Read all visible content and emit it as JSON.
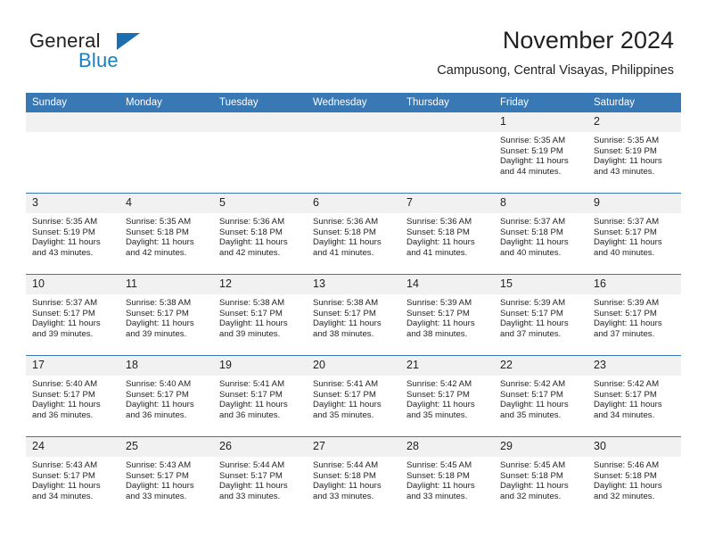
{
  "brand": {
    "word_one": "General",
    "word_two": "Blue",
    "logo_icon": "triangle-logo-icon",
    "accent_color": "#1a7fc1"
  },
  "header": {
    "month_title": "November 2024",
    "location": "Campusong, Central Visayas, Philippines"
  },
  "calendar": {
    "header_color": "#3878b5",
    "daynum_background": "#f1f1f1",
    "weekday_headers": [
      "Sunday",
      "Monday",
      "Tuesday",
      "Wednesday",
      "Thursday",
      "Friday",
      "Saturday"
    ],
    "labels": {
      "sunrise": "Sunrise:",
      "sunset": "Sunset:",
      "daylight": "Daylight:"
    },
    "weeks": [
      [
        {
          "day": "",
          "blank": true
        },
        {
          "day": "",
          "blank": true
        },
        {
          "day": "",
          "blank": true
        },
        {
          "day": "",
          "blank": true
        },
        {
          "day": "",
          "blank": true
        },
        {
          "day": "1",
          "sunrise": "Sunrise: 5:35 AM",
          "sunset": "Sunset: 5:19 PM",
          "daylight": "Daylight: 11 hours and 44 minutes."
        },
        {
          "day": "2",
          "sunrise": "Sunrise: 5:35 AM",
          "sunset": "Sunset: 5:19 PM",
          "daylight": "Daylight: 11 hours and 43 minutes."
        }
      ],
      [
        {
          "day": "3",
          "sunrise": "Sunrise: 5:35 AM",
          "sunset": "Sunset: 5:19 PM",
          "daylight": "Daylight: 11 hours and 43 minutes."
        },
        {
          "day": "4",
          "sunrise": "Sunrise: 5:35 AM",
          "sunset": "Sunset: 5:18 PM",
          "daylight": "Daylight: 11 hours and 42 minutes."
        },
        {
          "day": "5",
          "sunrise": "Sunrise: 5:36 AM",
          "sunset": "Sunset: 5:18 PM",
          "daylight": "Daylight: 11 hours and 42 minutes."
        },
        {
          "day": "6",
          "sunrise": "Sunrise: 5:36 AM",
          "sunset": "Sunset: 5:18 PM",
          "daylight": "Daylight: 11 hours and 41 minutes."
        },
        {
          "day": "7",
          "sunrise": "Sunrise: 5:36 AM",
          "sunset": "Sunset: 5:18 PM",
          "daylight": "Daylight: 11 hours and 41 minutes."
        },
        {
          "day": "8",
          "sunrise": "Sunrise: 5:37 AM",
          "sunset": "Sunset: 5:18 PM",
          "daylight": "Daylight: 11 hours and 40 minutes."
        },
        {
          "day": "9",
          "sunrise": "Sunrise: 5:37 AM",
          "sunset": "Sunset: 5:17 PM",
          "daylight": "Daylight: 11 hours and 40 minutes."
        }
      ],
      [
        {
          "day": "10",
          "sunrise": "Sunrise: 5:37 AM",
          "sunset": "Sunset: 5:17 PM",
          "daylight": "Daylight: 11 hours and 39 minutes."
        },
        {
          "day": "11",
          "sunrise": "Sunrise: 5:38 AM",
          "sunset": "Sunset: 5:17 PM",
          "daylight": "Daylight: 11 hours and 39 minutes."
        },
        {
          "day": "12",
          "sunrise": "Sunrise: 5:38 AM",
          "sunset": "Sunset: 5:17 PM",
          "daylight": "Daylight: 11 hours and 39 minutes."
        },
        {
          "day": "13",
          "sunrise": "Sunrise: 5:38 AM",
          "sunset": "Sunset: 5:17 PM",
          "daylight": "Daylight: 11 hours and 38 minutes."
        },
        {
          "day": "14",
          "sunrise": "Sunrise: 5:39 AM",
          "sunset": "Sunset: 5:17 PM",
          "daylight": "Daylight: 11 hours and 38 minutes."
        },
        {
          "day": "15",
          "sunrise": "Sunrise: 5:39 AM",
          "sunset": "Sunset: 5:17 PM",
          "daylight": "Daylight: 11 hours and 37 minutes."
        },
        {
          "day": "16",
          "sunrise": "Sunrise: 5:39 AM",
          "sunset": "Sunset: 5:17 PM",
          "daylight": "Daylight: 11 hours and 37 minutes."
        }
      ],
      [
        {
          "day": "17",
          "sunrise": "Sunrise: 5:40 AM",
          "sunset": "Sunset: 5:17 PM",
          "daylight": "Daylight: 11 hours and 36 minutes."
        },
        {
          "day": "18",
          "sunrise": "Sunrise: 5:40 AM",
          "sunset": "Sunset: 5:17 PM",
          "daylight": "Daylight: 11 hours and 36 minutes."
        },
        {
          "day": "19",
          "sunrise": "Sunrise: 5:41 AM",
          "sunset": "Sunset: 5:17 PM",
          "daylight": "Daylight: 11 hours and 36 minutes."
        },
        {
          "day": "20",
          "sunrise": "Sunrise: 5:41 AM",
          "sunset": "Sunset: 5:17 PM",
          "daylight": "Daylight: 11 hours and 35 minutes."
        },
        {
          "day": "21",
          "sunrise": "Sunrise: 5:42 AM",
          "sunset": "Sunset: 5:17 PM",
          "daylight": "Daylight: 11 hours and 35 minutes."
        },
        {
          "day": "22",
          "sunrise": "Sunrise: 5:42 AM",
          "sunset": "Sunset: 5:17 PM",
          "daylight": "Daylight: 11 hours and 35 minutes."
        },
        {
          "day": "23",
          "sunrise": "Sunrise: 5:42 AM",
          "sunset": "Sunset: 5:17 PM",
          "daylight": "Daylight: 11 hours and 34 minutes."
        }
      ],
      [
        {
          "day": "24",
          "sunrise": "Sunrise: 5:43 AM",
          "sunset": "Sunset: 5:17 PM",
          "daylight": "Daylight: 11 hours and 34 minutes."
        },
        {
          "day": "25",
          "sunrise": "Sunrise: 5:43 AM",
          "sunset": "Sunset: 5:17 PM",
          "daylight": "Daylight: 11 hours and 33 minutes."
        },
        {
          "day": "26",
          "sunrise": "Sunrise: 5:44 AM",
          "sunset": "Sunset: 5:17 PM",
          "daylight": "Daylight: 11 hours and 33 minutes."
        },
        {
          "day": "27",
          "sunrise": "Sunrise: 5:44 AM",
          "sunset": "Sunset: 5:18 PM",
          "daylight": "Daylight: 11 hours and 33 minutes."
        },
        {
          "day": "28",
          "sunrise": "Sunrise: 5:45 AM",
          "sunset": "Sunset: 5:18 PM",
          "daylight": "Daylight: 11 hours and 33 minutes."
        },
        {
          "day": "29",
          "sunrise": "Sunrise: 5:45 AM",
          "sunset": "Sunset: 5:18 PM",
          "daylight": "Daylight: 11 hours and 32 minutes."
        },
        {
          "day": "30",
          "sunrise": "Sunrise: 5:46 AM",
          "sunset": "Sunset: 5:18 PM",
          "daylight": "Daylight: 11 hours and 32 minutes."
        }
      ]
    ]
  }
}
